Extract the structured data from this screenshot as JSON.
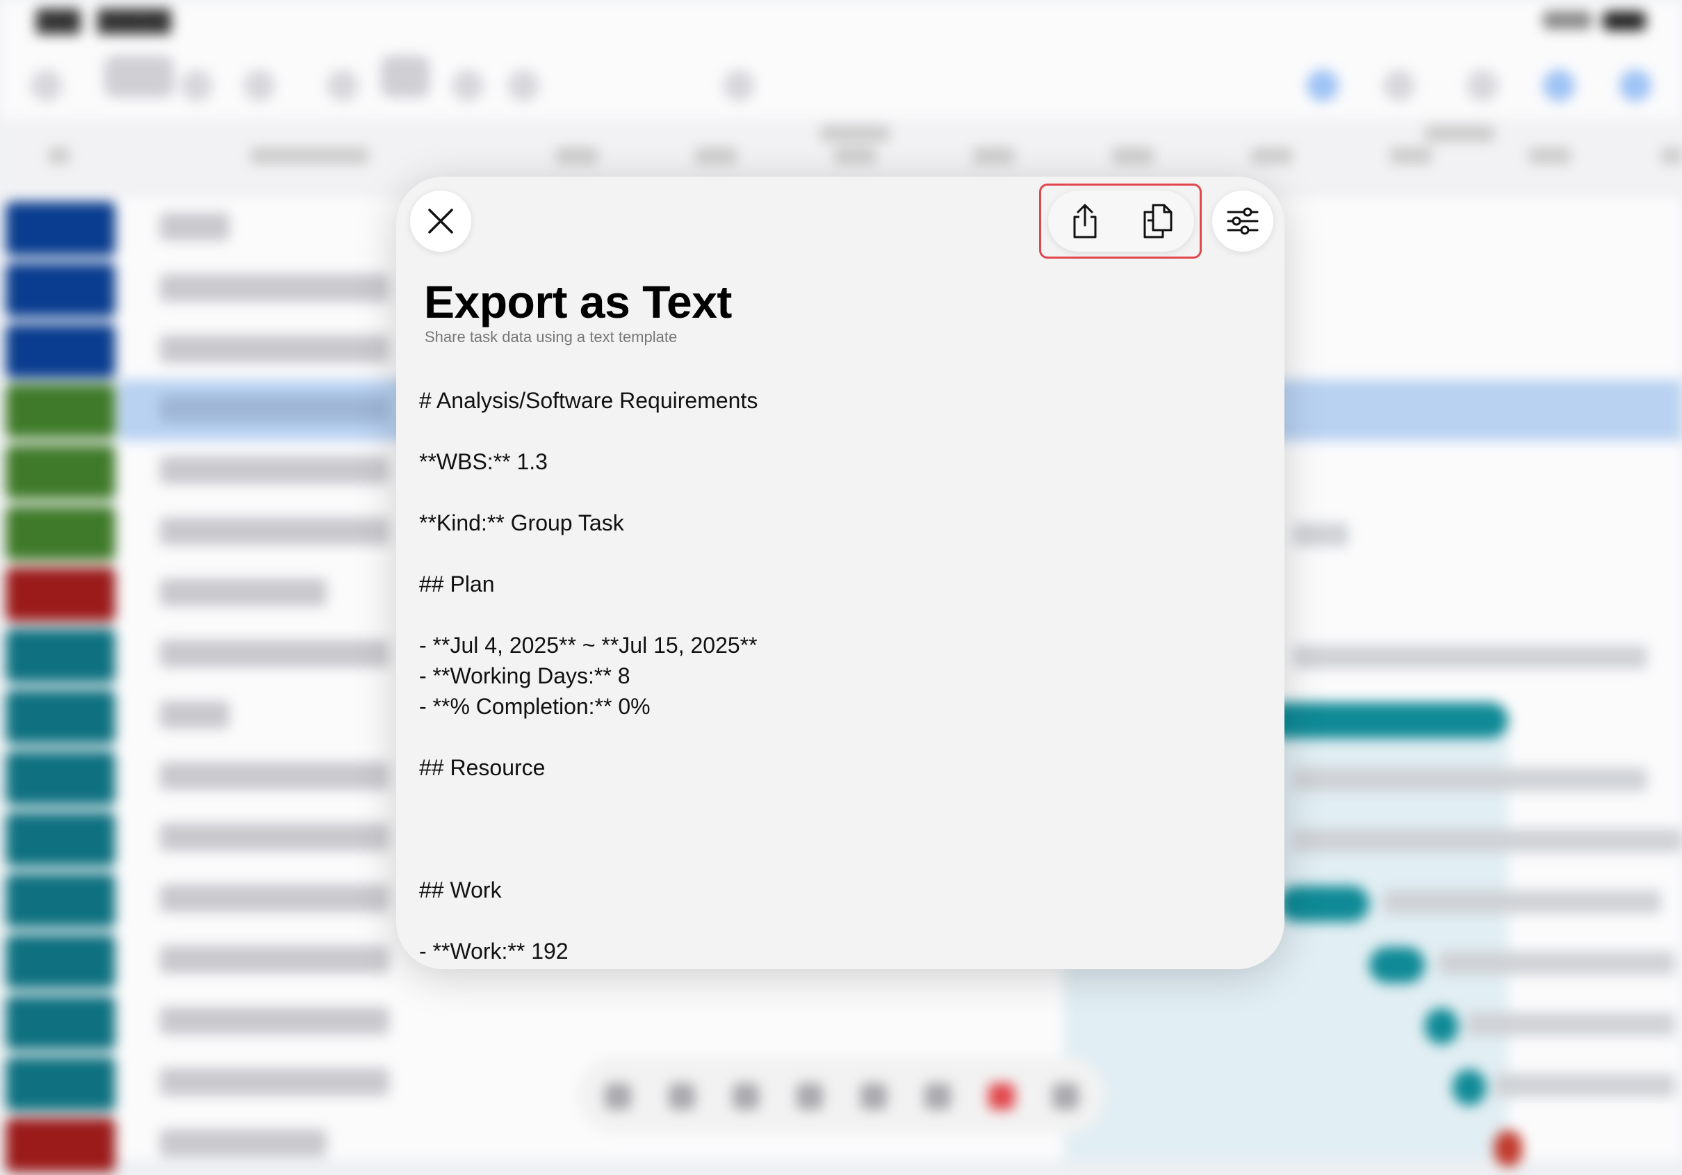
{
  "modal": {
    "title": "Export as Text",
    "subtitle": "Share task data using a text template",
    "buttons": {
      "close_icon": "close-icon",
      "share_icon": "share-icon",
      "copy_icon": "copy-icon",
      "settings_icon": "sliders-icon"
    },
    "highlight_color": "#e0474c",
    "text_lines": {
      "heading": "# Analysis/Software Requirements",
      "wbs": "**WBS:** 1.3",
      "kind": "**Kind:** Group Task",
      "plan_heading": "## Plan",
      "plan_dates": "- **Jul 4, 2025** ~ **Jul 15, 2025**",
      "plan_working_days": "- **Working Days:** 8",
      "plan_completion": "- **% Completion:** 0%",
      "resource_heading": "## Resource",
      "work_heading": "## Work",
      "work_value": "- **Work:** 192"
    }
  },
  "colors": {
    "swatch_blue": "#0a3d8f",
    "swatch_green": "#3f7a2a",
    "swatch_red": "#9b1b1b",
    "swatch_teal": "#0f7180",
    "highlight_row": "#b9d2f2"
  }
}
